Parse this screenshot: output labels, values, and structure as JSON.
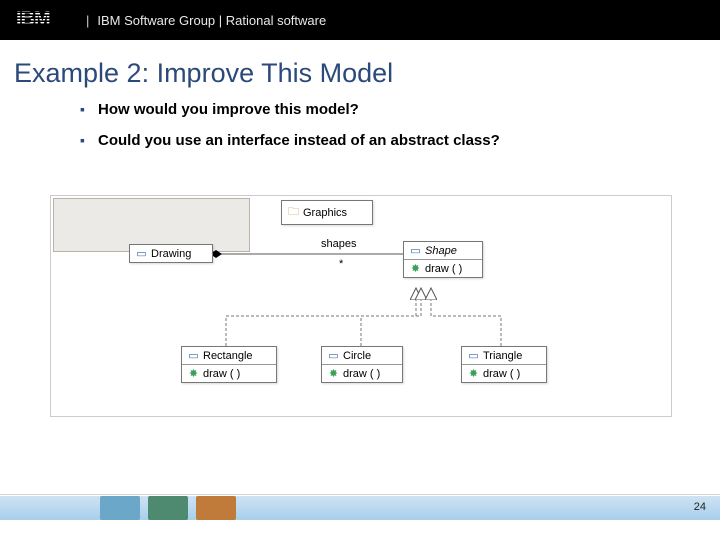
{
  "header": {
    "group_text": "IBM Software Group | Rational software"
  },
  "title": "Example 2: Improve This Model",
  "bullets": [
    "How would you improve this model?",
    "Could you use an interface instead of an abstract class?"
  ],
  "diagram": {
    "package": "Graphics",
    "drawing": "Drawing",
    "shape_class": "Shape",
    "shape_op": "draw ( )",
    "assoc_label": "shapes",
    "assoc_mult": "*",
    "children": [
      {
        "name": "Rectangle",
        "op": "draw ( )"
      },
      {
        "name": "Circle",
        "op": "draw ( )"
      },
      {
        "name": "Triangle",
        "op": "draw ( )"
      }
    ]
  },
  "page_number": "24"
}
